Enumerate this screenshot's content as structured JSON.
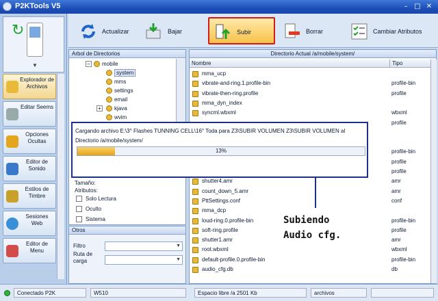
{
  "window": {
    "title": "P2KTools V5"
  },
  "nav": {
    "items": [
      {
        "label": "Explorador de Archivos"
      },
      {
        "label": "Editar Seems"
      },
      {
        "label": "Opciones Ocultas"
      },
      {
        "label": "Editor de Sonido"
      },
      {
        "label": "Estilos de Timbre"
      },
      {
        "label": "Sesiones Web"
      },
      {
        "label": "Editor de Menu"
      }
    ]
  },
  "toolbar": {
    "refresh": "Actualizar",
    "download": "Bajar",
    "upload": "Subir",
    "delete": "Borrar",
    "change_attrs": "Cambiar Atributos"
  },
  "tree": {
    "header": "Arbol de Directorios",
    "nodes": [
      "mobile",
      "system",
      "mms",
      "settings",
      "email",
      "kjava",
      "wvim"
    ],
    "size_label": "Tamaño:",
    "attrs_label": "Atributos:",
    "attr_readonly": "Solo Lectura",
    "attr_hidden": "Oculto",
    "attr_system": "Sistema"
  },
  "otros": {
    "header": "Otros",
    "filter_label": "Filtro",
    "path_label": "Ruta de carga"
  },
  "files": {
    "header": "Directorio Actual /a/mobile/system/",
    "col_name": "Nombre",
    "col_type": "Tipo",
    "rows": [
      {
        "name": "mma_ucp",
        "type": ""
      },
      {
        "name": "vibrate-and-ring.1.profile-bin",
        "type": "profile-bin"
      },
      {
        "name": "vibrate-then-ring.profile",
        "type": "profile"
      },
      {
        "name": "mma_dyn_index",
        "type": ""
      },
      {
        "name": "syncml.wbxml",
        "type": "wbxml"
      },
      {
        "name": "",
        "type": "profile"
      },
      {
        "name": "",
        "type": ""
      },
      {
        "name": "",
        "type": ""
      },
      {
        "name": "",
        "type": "profile-bin"
      },
      {
        "name": "",
        "type": "profile"
      },
      {
        "name": "",
        "type": "profile"
      },
      {
        "name": "shutter4.amr",
        "type": "amr"
      },
      {
        "name": "count_down_5.amr",
        "type": "amr"
      },
      {
        "name": "PttSettings.conf",
        "type": "conf"
      },
      {
        "name": "mma_dcp",
        "type": ""
      },
      {
        "name": "loud-ring.0.profile-bin",
        "type": "profile-bin"
      },
      {
        "name": "soft-ring.profile",
        "type": "profile"
      },
      {
        "name": "shutter1.amr",
        "type": "amr"
      },
      {
        "name": "root.wbxml",
        "type": "wbxml"
      },
      {
        "name": "default-profile.0.profile-bin",
        "type": "profile-bin"
      },
      {
        "name": "audio_cfg.db",
        "type": "db"
      }
    ]
  },
  "progress": {
    "message": "Cargando archivo E:\\3° Flashes TUNNING CELL\\16° Toda para Z3\\SUBIR VOLUMEN Z3\\SUBIR VOLUMEN al Directorio /a/mobile/system/",
    "percent_label": "13%",
    "fraction": 0.13
  },
  "annotation": {
    "line1": "Subiendo",
    "line2": "Audio cfg."
  },
  "status": {
    "connection": "Conectado P2K",
    "model": "W510",
    "free_space": "Espacio libre /a 2501 Kb",
    "section": "archivos"
  }
}
